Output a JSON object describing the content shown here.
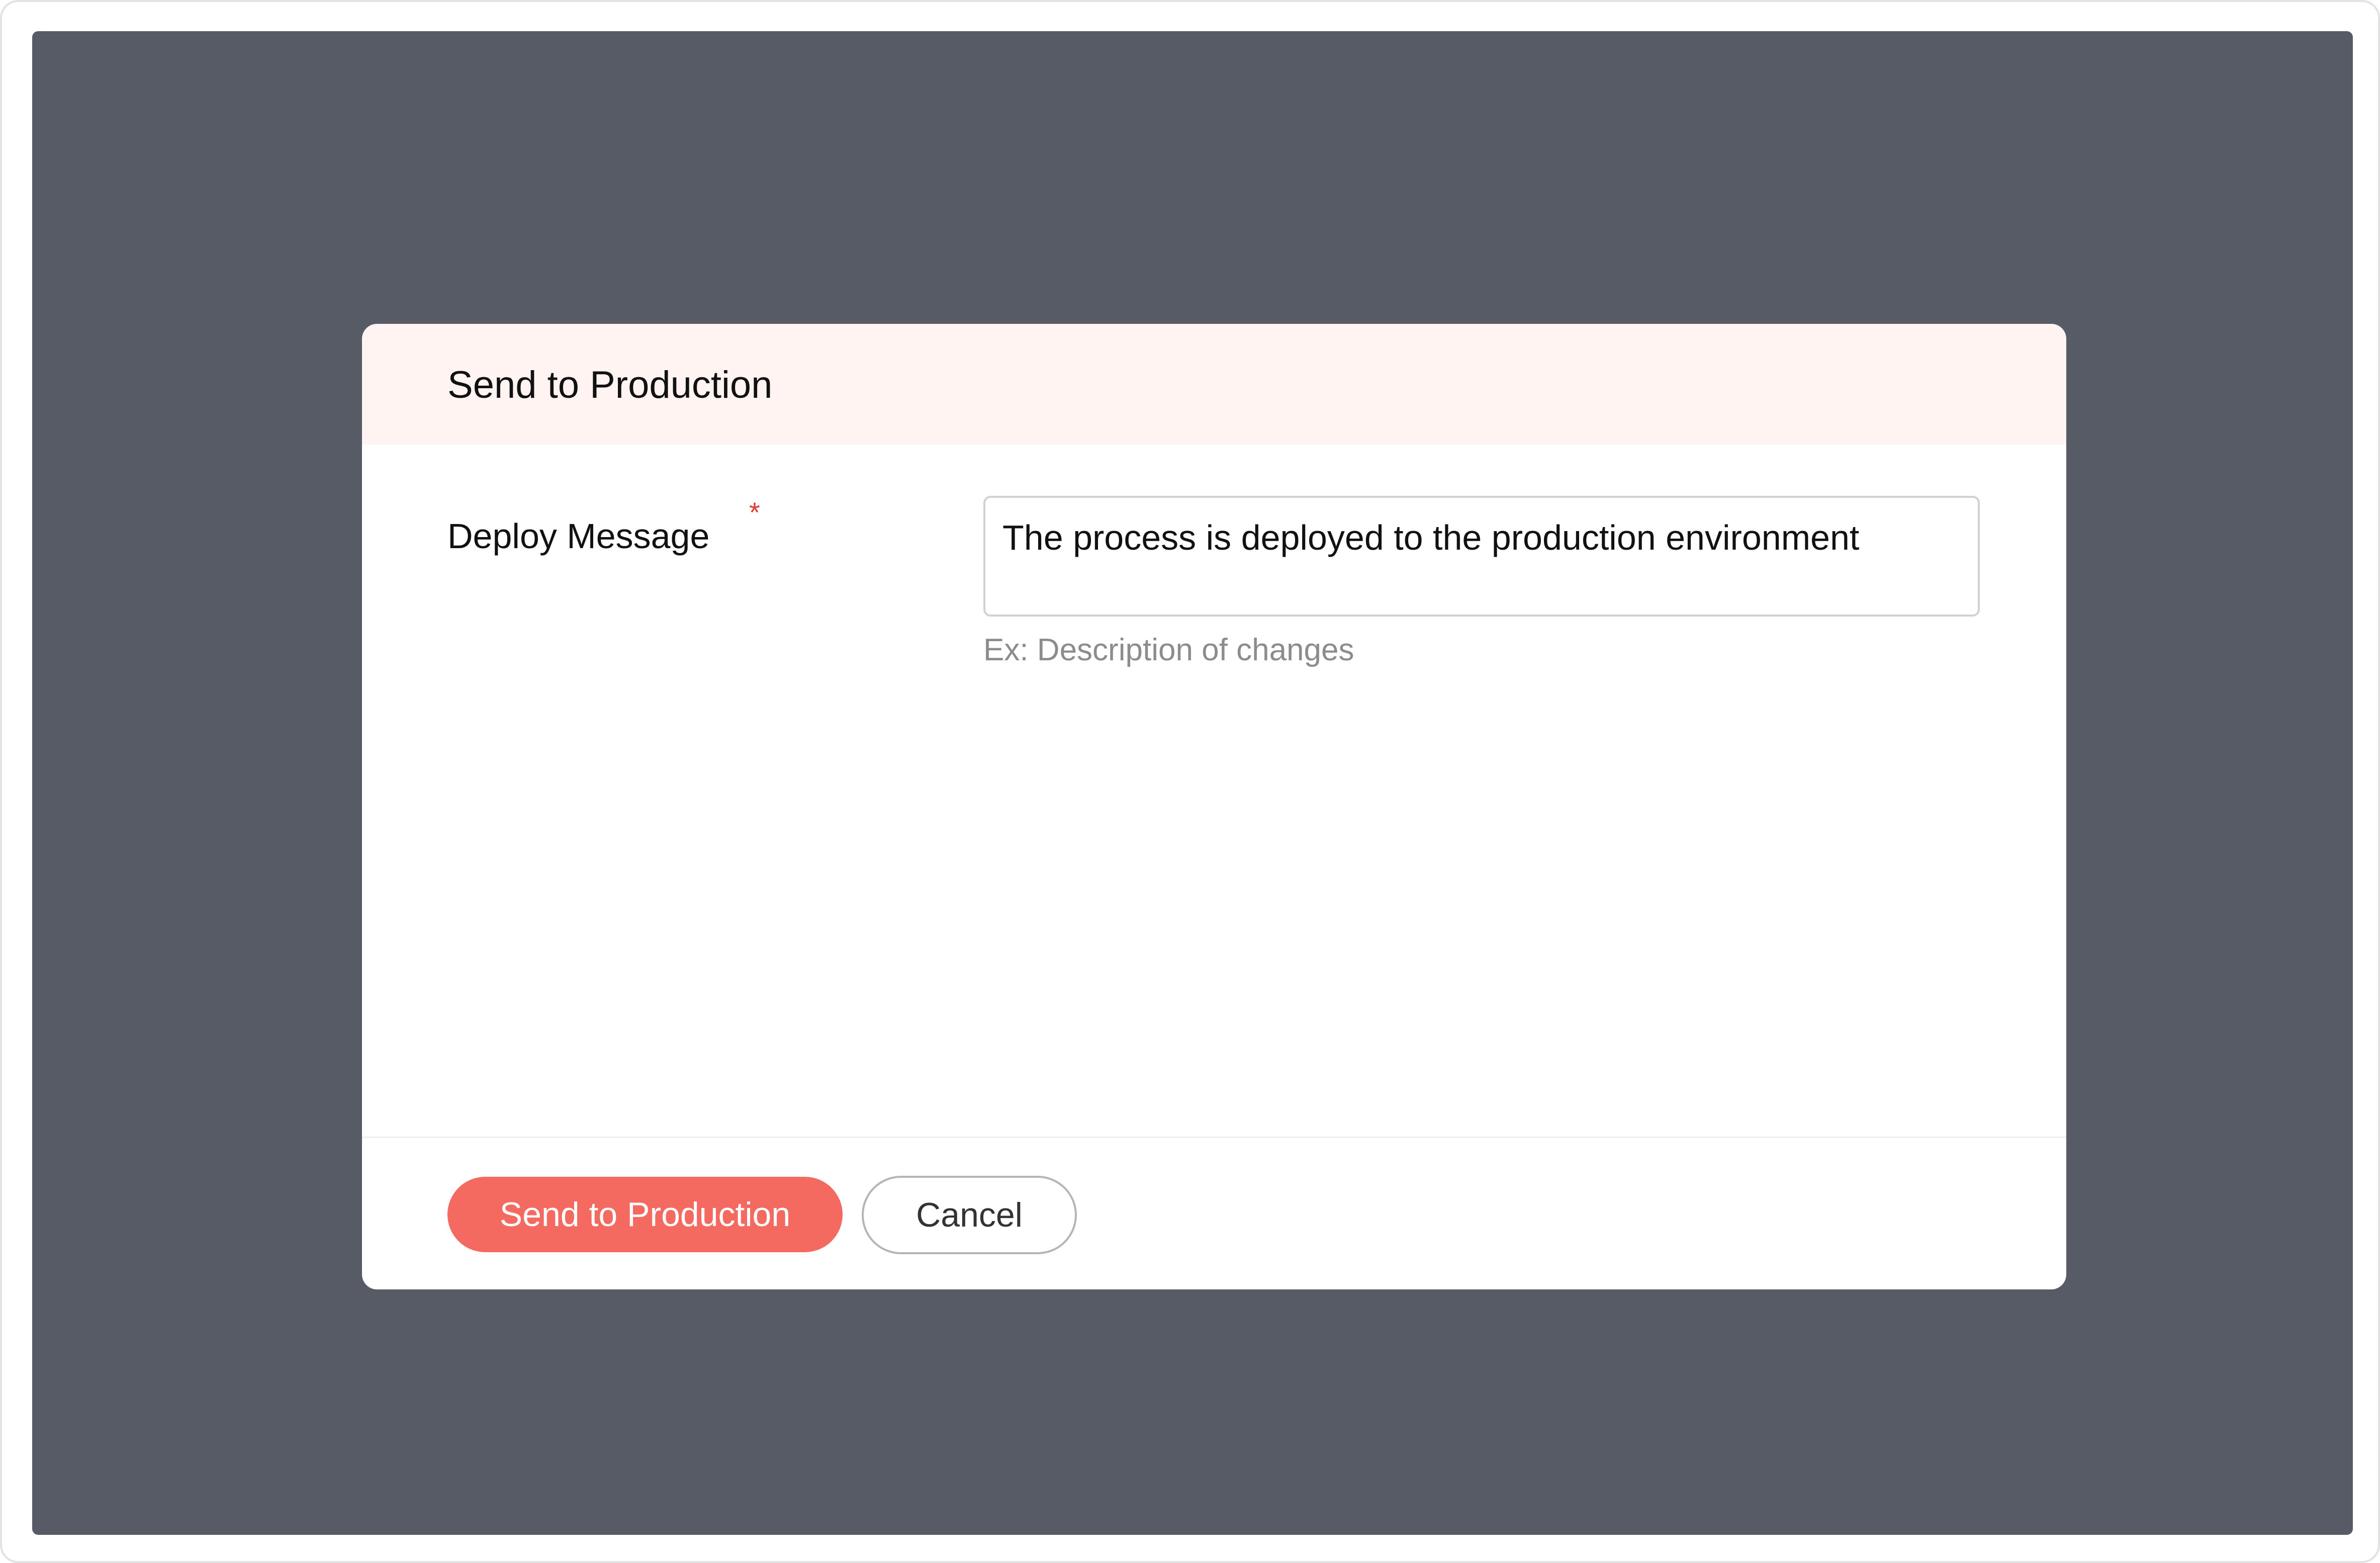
{
  "dialog": {
    "title": "Send to Production",
    "field": {
      "label": "Deploy Message",
      "required_mark": "*",
      "value": "The process is deployed to the production environment",
      "helper": "Ex: Description of changes"
    },
    "actions": {
      "primary_label": "Send to Production",
      "secondary_label": "Cancel"
    }
  },
  "colors": {
    "accent": "#f46a60",
    "header_background": "#fff4f2",
    "overlay": "#575b65",
    "required": "#e53935"
  }
}
